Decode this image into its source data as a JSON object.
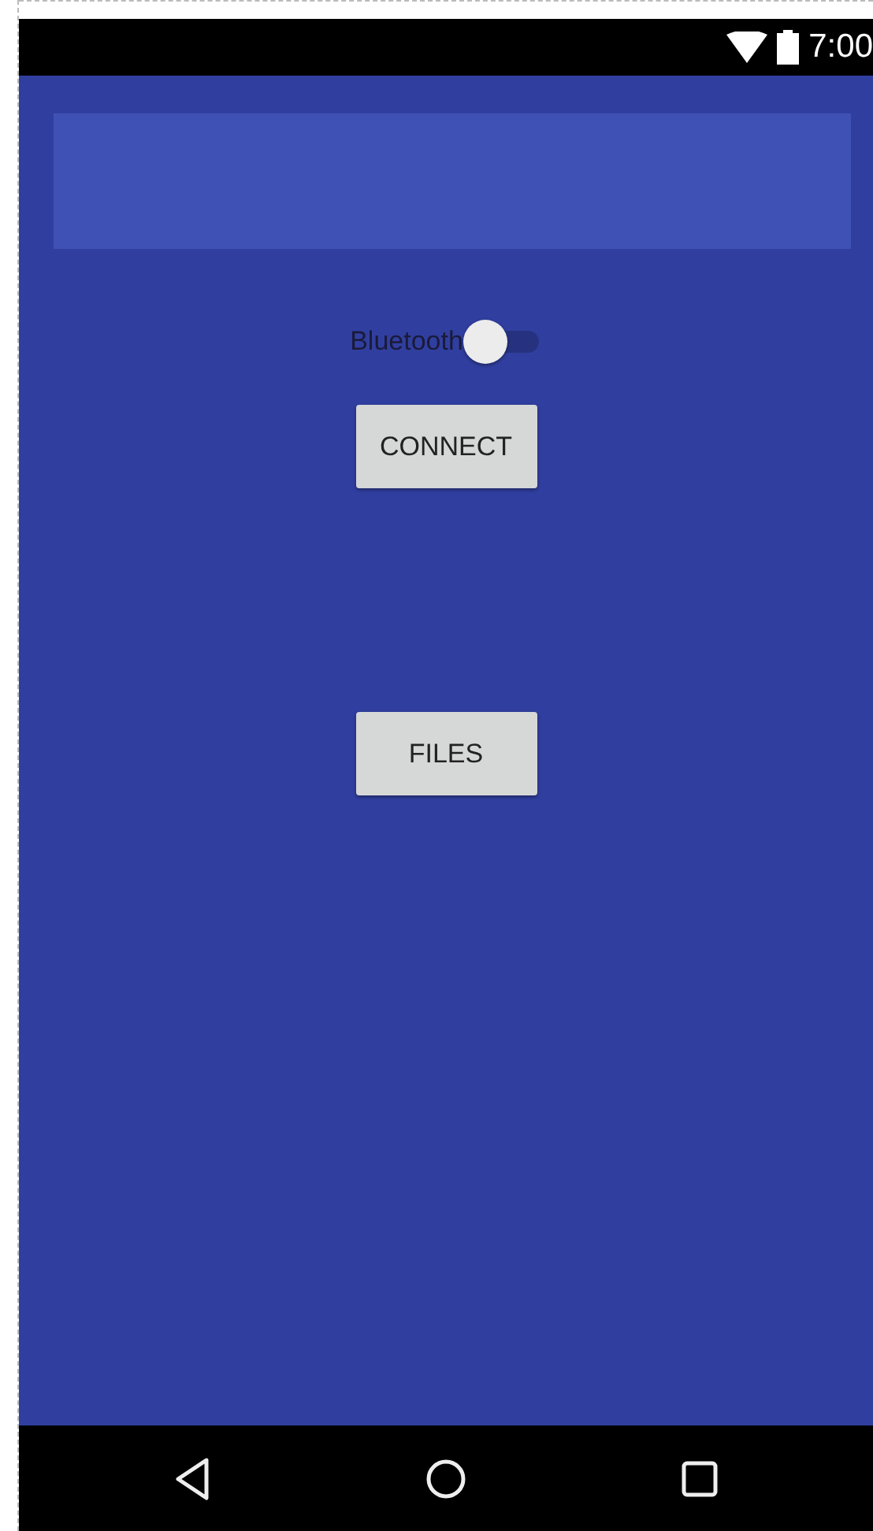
{
  "status_bar": {
    "time": "7:00"
  },
  "bluetooth_switch": {
    "label": "Bluetooth",
    "on": false
  },
  "buttons": [
    {
      "label": "CONNECT"
    },
    {
      "label": "FILES"
    }
  ]
}
